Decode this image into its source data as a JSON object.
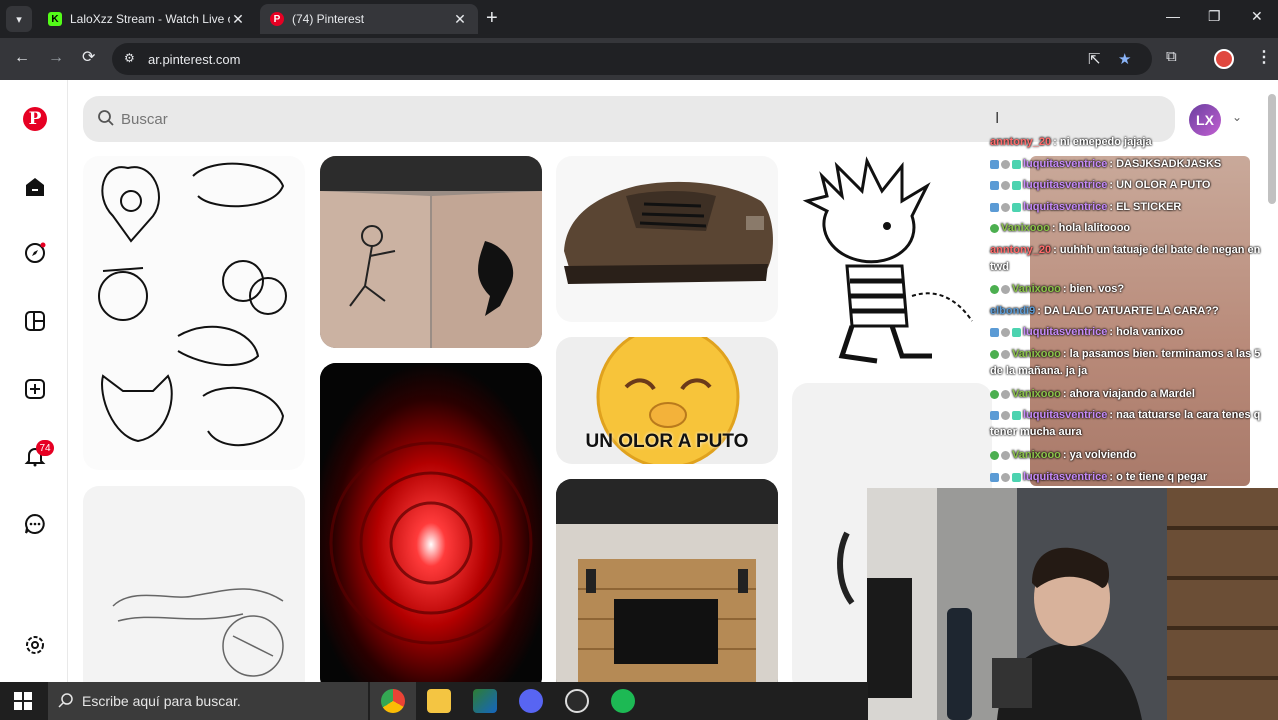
{
  "browser": {
    "tabs": [
      {
        "title": "LaloXzz Stream - Watch Live on",
        "favicon": "kick-icon",
        "color": "#53fc18"
      },
      {
        "title": "(74) Pinterest",
        "favicon": "pinterest-icon",
        "color": "#e60023"
      }
    ],
    "url": "ar.pinterest.com"
  },
  "pinterest": {
    "search_placeholder": "Buscar",
    "avatar_initials": "LX",
    "notification_count": "74",
    "sidebar": [
      "home-icon",
      "explore-icon",
      "boards-icon",
      "create-icon",
      "notifications-icon",
      "messages-icon",
      "settings-icon"
    ],
    "pins": [
      {
        "kind": "tattoo-flash-sketches"
      },
      {
        "kind": "arm-tattoos-photo"
      },
      {
        "kind": "brown-sneaker"
      },
      {
        "kind": "calvin-cartoon-sticker"
      },
      {
        "kind": "emoji-meme",
        "caption": "UN OLOR A PUTO"
      },
      {
        "kind": "red-spiral-tunnel"
      },
      {
        "kind": "wood-tv-wall"
      },
      {
        "kind": "lettering-tattoo-sketch"
      }
    ]
  },
  "stream_chat": [
    {
      "user": "anntony_20",
      "text": "ni emepedo jajaja",
      "color": "#ff6b6b"
    },
    {
      "user": "luquitasventrice",
      "text": "DASJKSADKJASKS",
      "color": "#c58af9"
    },
    {
      "user": "luquitasventrice",
      "text": "UN OLOR A PUTO",
      "color": "#c58af9"
    },
    {
      "user": "luquitasventrice",
      "text": "EL STICKER",
      "color": "#c58af9"
    },
    {
      "user": "Vanixooo",
      "text": "hola lalitoooo",
      "color": "#8bc34a"
    },
    {
      "user": "anntony_20",
      "text": "uuhhh un tatuaje del bate de negan en twd",
      "color": "#ff6b6b"
    },
    {
      "user": "Vanixooo",
      "text": "bien. vos?",
      "color": "#8bc34a"
    },
    {
      "user": "elbondi9",
      "text": "DA LALO TATUARTE LA CARA??",
      "color": "#5b9bd5"
    },
    {
      "user": "luquitasventrice",
      "text": "hola vanixoo",
      "color": "#c58af9"
    },
    {
      "user": "Vanixooo",
      "text": "la pasamos bien. terminamos a las 5 de la mañana. ja ja",
      "color": "#8bc34a"
    },
    {
      "user": "Vanixooo",
      "text": "ahora viajando a Mardel",
      "color": "#8bc34a"
    },
    {
      "user": "luquitasventrice",
      "text": "naa tatuarse la cara tenes q tener mucha aura",
      "color": "#c58af9"
    },
    {
      "user": "Vanixooo",
      "text": "ya volviendo",
      "color": "#8bc34a"
    },
    {
      "user": "luquitasventrice",
      "text": "o te tiene q pegar",
      "color": "#c58af9"
    }
  ],
  "taskbar": {
    "search_placeholder": "Escribe aquí para buscar.",
    "apps": [
      "chrome-icon",
      "file-explorer-icon",
      "app-icon",
      "discord-icon",
      "obs-icon",
      "spotify-icon"
    ]
  }
}
